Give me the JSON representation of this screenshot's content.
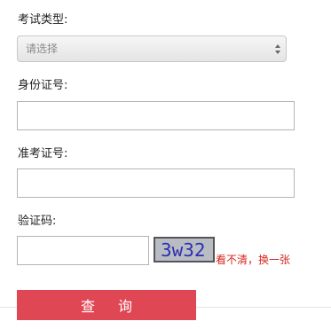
{
  "form": {
    "exam_type": {
      "label": "考试类型:",
      "selected": "请选择"
    },
    "id_number": {
      "label": "身份证号:",
      "value": ""
    },
    "admission_number": {
      "label": "准考证号:",
      "value": ""
    },
    "captcha": {
      "label": "验证码:",
      "value": "",
      "image_text": "3w32",
      "refresh_link": "看不清，换一张"
    },
    "submit_label": "查询"
  },
  "colors": {
    "accent": "#e04755",
    "link": "#d6261f",
    "captcha_text": "#2f2fb0"
  }
}
